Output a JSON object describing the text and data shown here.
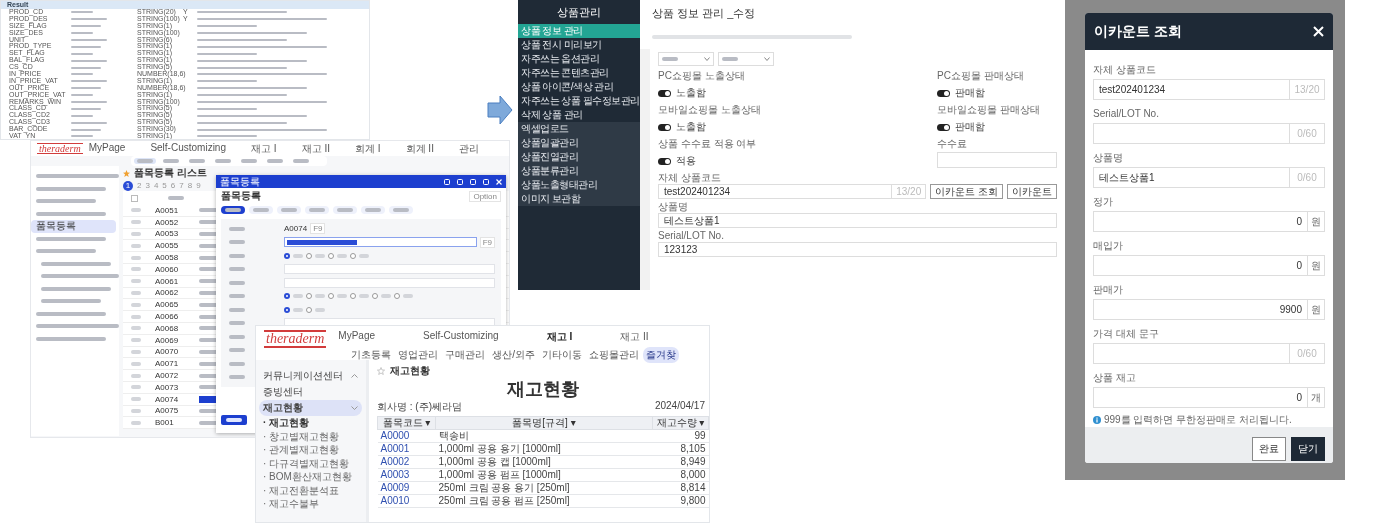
{
  "result_table": {
    "title": "Result",
    "rows": [
      {
        "field": "PROD_CD",
        "type": "STRING(20)",
        "required": "Y"
      },
      {
        "field": "PROD_DES",
        "type": "STRING(100)",
        "required": "Y"
      },
      {
        "field": "SIZE_FLAG",
        "type": "STRING(1)"
      },
      {
        "field": "SIZE_DES",
        "type": "STRING(100)"
      },
      {
        "field": "UNIT",
        "type": "STRING(6)"
      },
      {
        "field": "PROD_TYPE",
        "type": "STRING(1)"
      },
      {
        "field": "SET_FLAG",
        "type": "STRING(1)"
      },
      {
        "field": "BAL_FLAG",
        "type": "STRING(1)"
      },
      {
        "field": "CS_CD",
        "type": "STRING(5)"
      },
      {
        "field": "IN_PRICE",
        "type": "NUMBER(18,6)"
      },
      {
        "field": "IN_PRICE_VAT",
        "type": "STRING(1)"
      },
      {
        "field": "OUT_PRICE",
        "type": "NUMBER(18,6)"
      },
      {
        "field": "OUT_PRICE_VAT",
        "type": "STRING(1)"
      },
      {
        "field": "REMARKS_WIN",
        "type": "STRING(100)"
      },
      {
        "field": "CLASS_CD",
        "type": "STRING(5)"
      },
      {
        "field": "CLASS_CD2",
        "type": "STRING(5)"
      },
      {
        "field": "CLASS_CD3",
        "type": "STRING(5)"
      },
      {
        "field": "BAR_CODE",
        "type": "STRING(30)"
      },
      {
        "field": "VAT_YN",
        "type": "STRING(1)"
      }
    ]
  },
  "item_app": {
    "logo": "theraderm",
    "nav": [
      "MyPage",
      "Self-Customizing",
      "재고 I",
      "재고 II",
      "회계 I",
      "회계 II",
      "관리"
    ],
    "subtabs": [
      {
        "selected": true
      },
      {
        "selected": false
      },
      {
        "selected": false
      },
      {
        "selected": false
      },
      {
        "selected": false
      },
      {
        "selected": false
      },
      {
        "selected": false
      }
    ],
    "sidebar_current": "품목등록",
    "list_title": "품목등록 리스트",
    "pages": [
      {
        "label": "1",
        "selected": true
      },
      {
        "label": "2",
        "selected": false
      },
      {
        "label": "3",
        "selected": false
      },
      {
        "label": "4",
        "selected": false
      },
      {
        "label": "5",
        "selected": false
      },
      {
        "label": "6",
        "selected": false
      },
      {
        "label": "7",
        "selected": false
      },
      {
        "label": "8",
        "selected": false
      },
      {
        "label": "9",
        "selected": false
      }
    ],
    "select_all": {
      "checked": false
    },
    "rows": [
      {
        "code": "A0051",
        "selected": false
      },
      {
        "code": "A0052",
        "selected": false
      },
      {
        "code": "A0053",
        "selected": false
      },
      {
        "code": "A0055",
        "selected": false
      },
      {
        "code": "A0058",
        "selected": false
      },
      {
        "code": "A0060",
        "selected": false
      },
      {
        "code": "A0061",
        "selected": false
      },
      {
        "code": "A0062",
        "selected": false
      },
      {
        "code": "A0065",
        "selected": false
      },
      {
        "code": "A0066",
        "selected": false
      },
      {
        "code": "A0068",
        "selected": false
      },
      {
        "code": "A0069",
        "selected": false
      },
      {
        "code": "A0070",
        "selected": false
      },
      {
        "code": "A0071",
        "selected": false
      },
      {
        "code": "A0072",
        "selected": false
      },
      {
        "code": "A0073",
        "selected": false
      },
      {
        "code": "A0074",
        "selected": true
      },
      {
        "code": "A0075",
        "selected": false
      },
      {
        "code": "B001",
        "selected": false
      }
    ],
    "dialog": {
      "title": "품목등록",
      "heading": "품목등록",
      "option": "Option",
      "tabs": [
        {
          "selected": true
        },
        {
          "selected": false
        },
        {
          "selected": false
        },
        {
          "selected": false
        },
        {
          "selected": false
        },
        {
          "selected": false
        },
        {
          "selected": false
        }
      ],
      "code": "A0074",
      "code_key": "F9",
      "name_key": "F9",
      "radio_groups": [
        [
          {
            "checked": true
          },
          {
            "checked": false
          },
          {
            "checked": false
          },
          {
            "checked": false
          }
        ],
        [
          {
            "checked": true
          },
          {
            "checked": false
          },
          {
            "checked": false
          },
          {
            "checked": false
          },
          {
            "checked": false
          },
          {
            "checked": false
          }
        ],
        [
          {
            "checked": true
          },
          {
            "checked": false
          }
        ]
      ]
    }
  },
  "stock_app": {
    "logo": "theraderm",
    "nav": [
      {
        "label": "MyPage",
        "selected": false
      },
      {
        "label": "Self-Customizing",
        "selected": false
      },
      {
        "label": "재고 I",
        "selected": true
      },
      {
        "label": "재고 II",
        "selected": false
      }
    ],
    "subtabs": [
      {
        "label": "기초등록",
        "selected": false
      },
      {
        "label": "영업관리",
        "selected": false
      },
      {
        "label": "구매관리",
        "selected": false
      },
      {
        "label": "생산/외주",
        "selected": false
      },
      {
        "label": "기타이동",
        "selected": false
      },
      {
        "label": "쇼핑몰관리",
        "selected": false
      },
      {
        "label": "즐겨찾",
        "selected": true
      }
    ],
    "sidebar": [
      {
        "label": "커뮤니케이션센터",
        "kind": "group",
        "expanded": false,
        "selected": false
      },
      {
        "label": "증빙센터",
        "kind": "link",
        "selected": false
      },
      {
        "label": "재고현황",
        "kind": "group",
        "expanded": true,
        "selected": true,
        "children": [
          {
            "label": "· 재고현황",
            "selected": true
          },
          {
            "label": "· 창고별재고현황",
            "selected": false
          },
          {
            "label": "· 관계별재고현황",
            "selected": false
          },
          {
            "label": "· 다규격별재고현황",
            "selected": false
          },
          {
            "label": "· BOM환산재고현황",
            "selected": false
          },
          {
            "label": "· 재고전환분석표",
            "selected": false
          },
          {
            "label": "· 재고수불부",
            "selected": false
          }
        ]
      }
    ],
    "breadcrumb": "재고현황",
    "report_title": "재고현황",
    "company": "회사명 : (주)쎄라덤",
    "date": "2024/04/17",
    "columns": [
      "품목코드 ▾",
      "품목명[규격] ▾",
      "재고수량 ▾"
    ],
    "rows": [
      [
        "A0000",
        "택송비",
        "99"
      ],
      [
        "A0001",
        "1,000ml 공용 용기 [1000ml]",
        "8,105"
      ],
      [
        "A0002",
        "1,000ml 공용 캡 [1000ml]",
        "8,949"
      ],
      [
        "A0003",
        "1,000ml 공용 펌프 [1000ml]",
        "8,000"
      ],
      [
        "A0009",
        "250ml 크림 공용 용기 [250ml]",
        "8,814"
      ],
      [
        "A0010",
        "250ml 크림 공용 펌프 [250ml]",
        "9,800"
      ]
    ]
  },
  "admin": {
    "sidebar_title": "상품관리",
    "menu": [
      {
        "label": "상품 정보 관리",
        "selected": true,
        "kind": "main"
      },
      {
        "label": "상품 전시 미리보기",
        "selected": false,
        "kind": "main"
      },
      {
        "label": "자주쓰는 옵션관리",
        "selected": false,
        "kind": "main"
      },
      {
        "label": "자주쓰는 콘텐츠관리",
        "selected": false,
        "kind": "main"
      },
      {
        "label": "상품 아이콘/색상 관리",
        "selected": false,
        "kind": "main"
      },
      {
        "label": "자주쓰는 상품 필수정보관리",
        "selected": false,
        "kind": "main"
      },
      {
        "label": "삭제 상품 관리",
        "selected": false,
        "kind": "main"
      },
      {
        "label": "엑셀업로드",
        "selected": false,
        "kind": "tool"
      },
      {
        "label": "상품일괄관리",
        "selected": false,
        "kind": "tool"
      },
      {
        "label": "상품진열관리",
        "selected": false,
        "kind": "tool"
      },
      {
        "label": "상품분류관리",
        "selected": false,
        "kind": "tool"
      },
      {
        "label": "상품노출형태관리",
        "selected": false,
        "kind": "tool"
      },
      {
        "label": "이미지 보관함",
        "selected": false,
        "kind": "tool"
      }
    ],
    "page_title": "상품 정보 관리 _수정",
    "settings": [
      {
        "kind": "toggle",
        "label": "PC쇼핑몰 노출상태",
        "value": "노출함",
        "on": true
      },
      {
        "kind": "toggle",
        "label": "PC쇼핑몰 판매상태",
        "value": "판매함",
        "on": true
      },
      {
        "kind": "toggle",
        "label": "모바일쇼핑몰 노출상태",
        "value": "노출함",
        "on": true
      },
      {
        "kind": "toggle",
        "label": "모바일쇼핑몰 판매상태",
        "value": "판매함",
        "on": true
      },
      {
        "kind": "toggle",
        "label": "상품 수수료 적용 여부",
        "value": "적용",
        "on": true
      },
      {
        "kind": "input",
        "label": "수수료"
      }
    ],
    "code": {
      "label": "자체 상품코드",
      "value": "test202401234",
      "counter": "13/20",
      "buttons": [
        "이카운트 조회",
        "이카운트"
      ]
    },
    "name": {
      "label": "상품명",
      "value": "테스트상품1"
    },
    "serial": {
      "label": "Serial/LOT No.",
      "value": "123123"
    }
  },
  "modal": {
    "title": "이카운트 조회",
    "fields": [
      {
        "label": "자체 상품코드",
        "value": "test202401234",
        "counter": "13/20"
      },
      {
        "label": "Serial/LOT No.",
        "counter": "0/60"
      },
      {
        "label": "상품명",
        "value": "테스트상품1",
        "counter": "0/60"
      },
      {
        "label": "정가",
        "value": "0",
        "unit": "원"
      },
      {
        "label": "매입가",
        "value": "0",
        "unit": "원"
      },
      {
        "label": "판매가",
        "value": "9900",
        "unit": "원"
      },
      {
        "label": "가격 대체 문구",
        "counter": "0/60"
      },
      {
        "label": "상품 재고",
        "value": "0",
        "unit": "개"
      }
    ],
    "note": "999를 입력하면 무한정판매로 처리됩니다.",
    "buttons": [
      {
        "label": "완료",
        "kind": "secondary"
      },
      {
        "label": "닫기",
        "kind": "primary"
      }
    ]
  }
}
